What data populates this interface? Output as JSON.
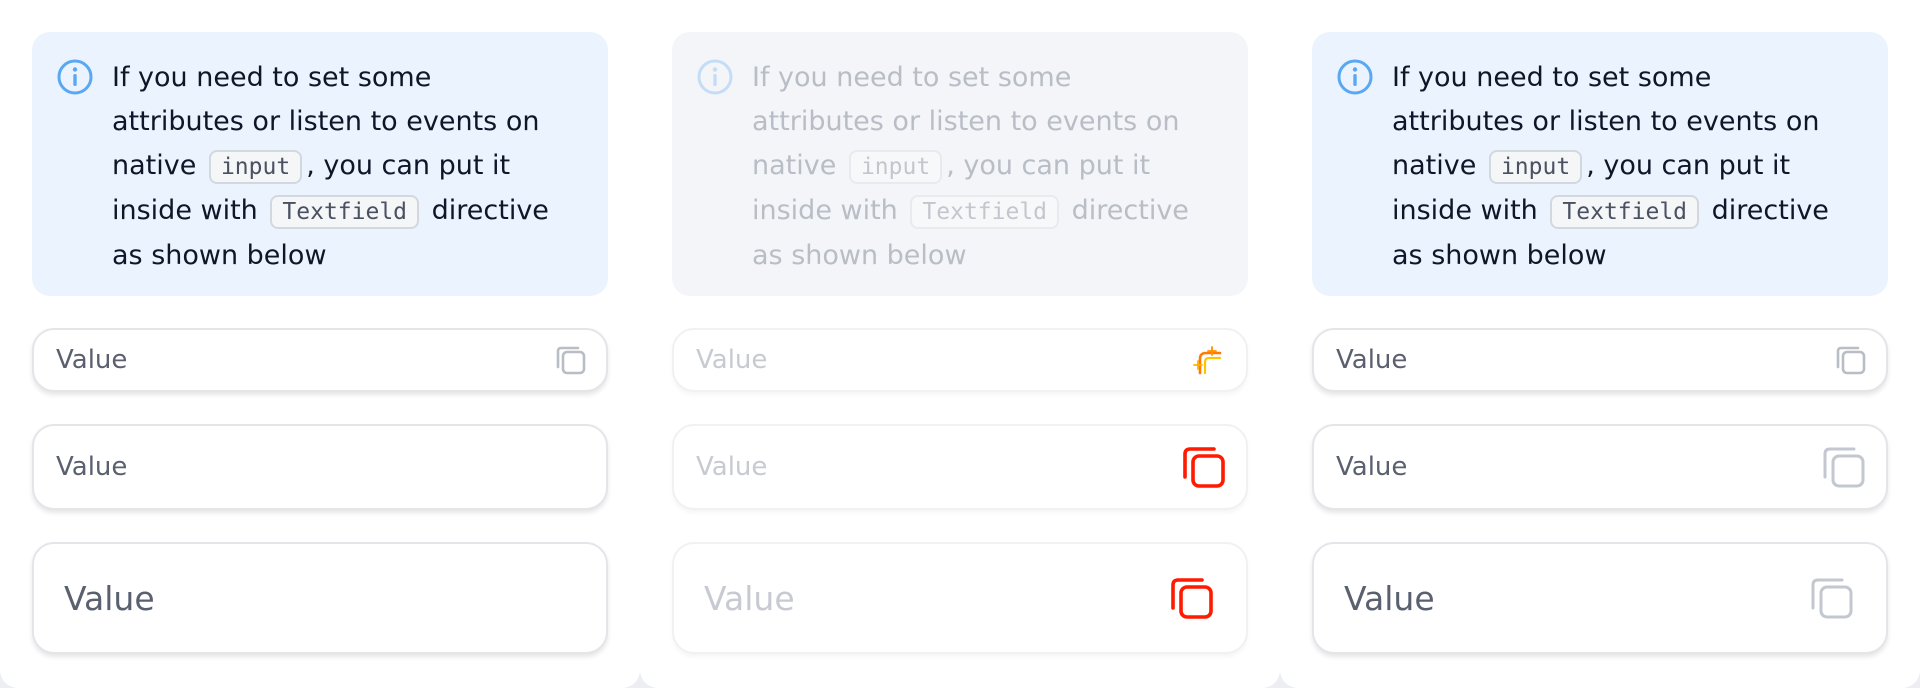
{
  "callout": {
    "text_1": "If you need to set some attributes or listen to events on native",
    "code_1": "input",
    "text_2": ", you can put it inside with",
    "code_2": "Textfield",
    "text_3": "directive as shown below"
  },
  "fields": {
    "small_value": "Value",
    "medium_value": "Value",
    "large_value": "Value"
  },
  "colors": {
    "callout_bg": "#eaf3fe",
    "info_icon": "#5aa8f2",
    "copy_icon_default": "#b8bdc6",
    "copy_icon_active": "#ff1a00"
  }
}
